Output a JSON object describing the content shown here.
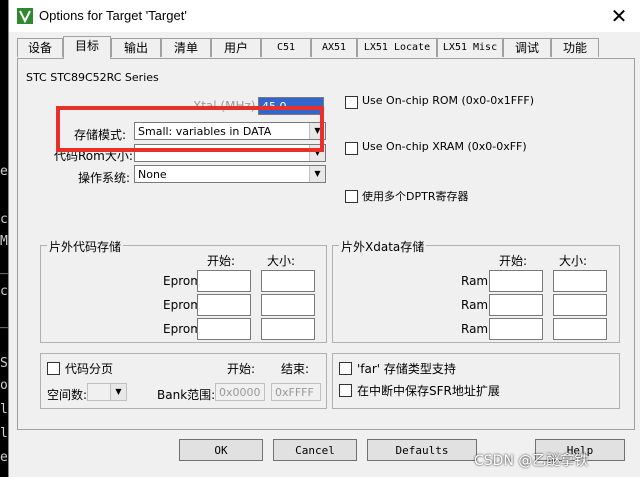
{
  "window": {
    "title": "Options for Target 'Target'",
    "close": "✕"
  },
  "tabs": [
    "设备",
    "目标",
    "输出",
    "清单",
    "用户",
    "C51",
    "AX51",
    "LX51 Locate",
    "LX51 Misc",
    "调试",
    "功能"
  ],
  "active_tab": "目标",
  "device": "STC STC89C52RC Series",
  "xtal": {
    "label": "Xtal (MHz)",
    "value": "45.0"
  },
  "memory_model": {
    "label": "存储模式:",
    "value": "Small: variables in DATA"
  },
  "code_rom_size": {
    "label": "代码Rom大小:",
    "value": ""
  },
  "os": {
    "label": "操作系统:",
    "value": "None"
  },
  "options": {
    "onchip_rom": "Use On-chip ROM (0x0-0x1FFF)",
    "onchip_xram": "Use On-chip XRAM (0x0-0xFF)",
    "multi_dptr": "使用多个DPTR寄存器"
  },
  "ext_code": {
    "title": "片外代码存储",
    "start": "开始:",
    "size": "大小:",
    "rows": [
      "Eprom",
      "Eprom",
      "Eprom"
    ]
  },
  "ext_xdata": {
    "title": "片外Xdata存储",
    "start": "开始:",
    "size": "大小:",
    "rows": [
      "Ram",
      "Ram",
      "Ram"
    ]
  },
  "banking": {
    "code_banking": "代码分页",
    "start": "开始:",
    "end": "结束:",
    "banks_label": "空间数:",
    "bank_range": "Bank范围:",
    "start_value": "0x0000",
    "end_value": "0xFFFF"
  },
  "far_options": {
    "far_support": "'far' 存储类型支持",
    "save_sfr": "在中断中保存SFR地址扩展"
  },
  "buttons": {
    "ok": "OK",
    "cancel": "Cancel",
    "defaults": "Defaults",
    "help": "Help"
  },
  "background_chars": [
    "e",
    "c",
    "M",
    "_",
    "c",
    "_",
    "S",
    "o",
    "l",
    "l",
    "e"
  ],
  "watermark": "CSDN @乙醚拿铁",
  "colors": {
    "highlight": "#e8302a"
  }
}
